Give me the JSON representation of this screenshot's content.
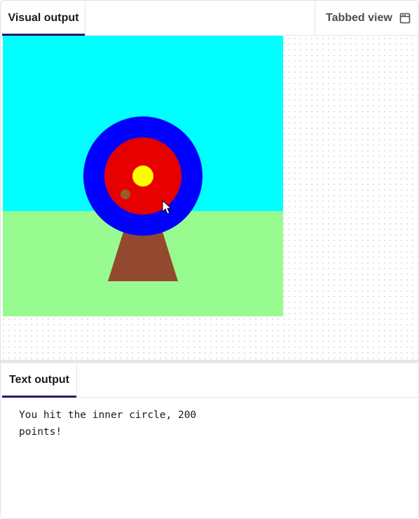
{
  "visual_panel": {
    "tab_label": "Visual output",
    "tabbed_view_label": "Tabbed view",
    "tabbed_view_icon": "window-icon"
  },
  "stage": {
    "sky_color": "#00ffff",
    "grass_color": "#98fb8f",
    "stand_color": "#93492f",
    "target_rings": [
      {
        "name": "outer-ring",
        "color": "#0000ff"
      },
      {
        "name": "middle-ring",
        "color": "#e60000"
      },
      {
        "name": "inner-ring",
        "color": "#ffff00"
      }
    ],
    "arrow_mark_color": "#9a5a2e",
    "cursor_icon": "mouse-pointer-icon"
  },
  "text_panel": {
    "tab_label": "Text output",
    "output": "You hit the inner circle, 200 points!"
  }
}
